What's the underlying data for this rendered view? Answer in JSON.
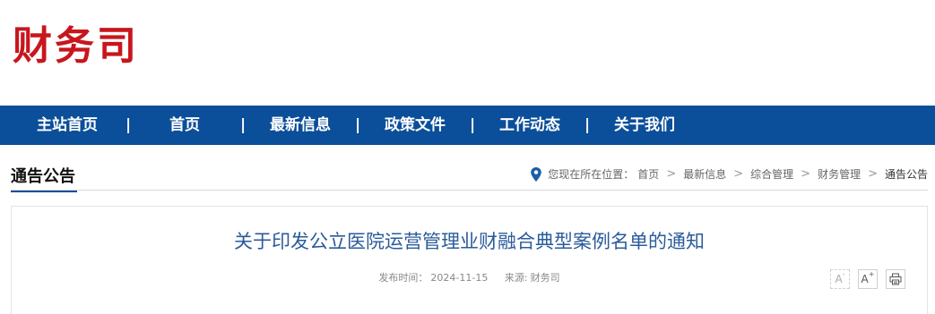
{
  "site": {
    "logo_text": "财务司"
  },
  "nav": {
    "items": [
      "主站首页",
      "首页",
      "最新信息",
      "政策文件",
      "工作动态",
      "关于我们"
    ],
    "separator": "|"
  },
  "section": {
    "title": "通告公告"
  },
  "breadcrumb": {
    "prefix": "您现在所在位置：",
    "items": [
      "首页",
      "最新信息",
      "综合管理",
      "财务管理"
    ],
    "current": "通告公告",
    "separator": ">"
  },
  "article": {
    "title": "关于印发公立医院运营管理业财融合典型案例名单的通知",
    "publish_label": "发布时间：",
    "publish_date": "2024-11-15",
    "source_label": "来源:",
    "source": "财务司"
  },
  "tools": {
    "font_decrease": "A",
    "font_decrease_mark": "-",
    "font_increase": "A",
    "font_increase_mark": "+"
  },
  "colors": {
    "brand_red": "#c8161d",
    "nav_blue": "#0b4e99",
    "title_blue": "#2a5b9a"
  }
}
